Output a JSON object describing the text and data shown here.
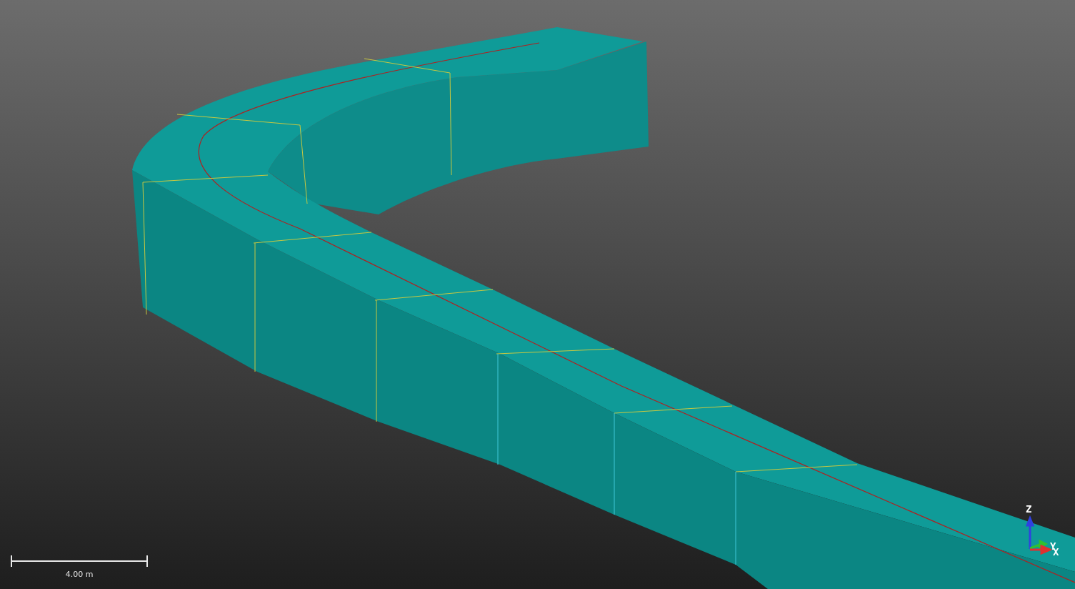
{
  "viewport": {
    "scale_bar": {
      "label": "4.00 m"
    },
    "axis_triad": {
      "z_label": "Z",
      "y_label": "Y",
      "x_label": "X"
    }
  }
}
